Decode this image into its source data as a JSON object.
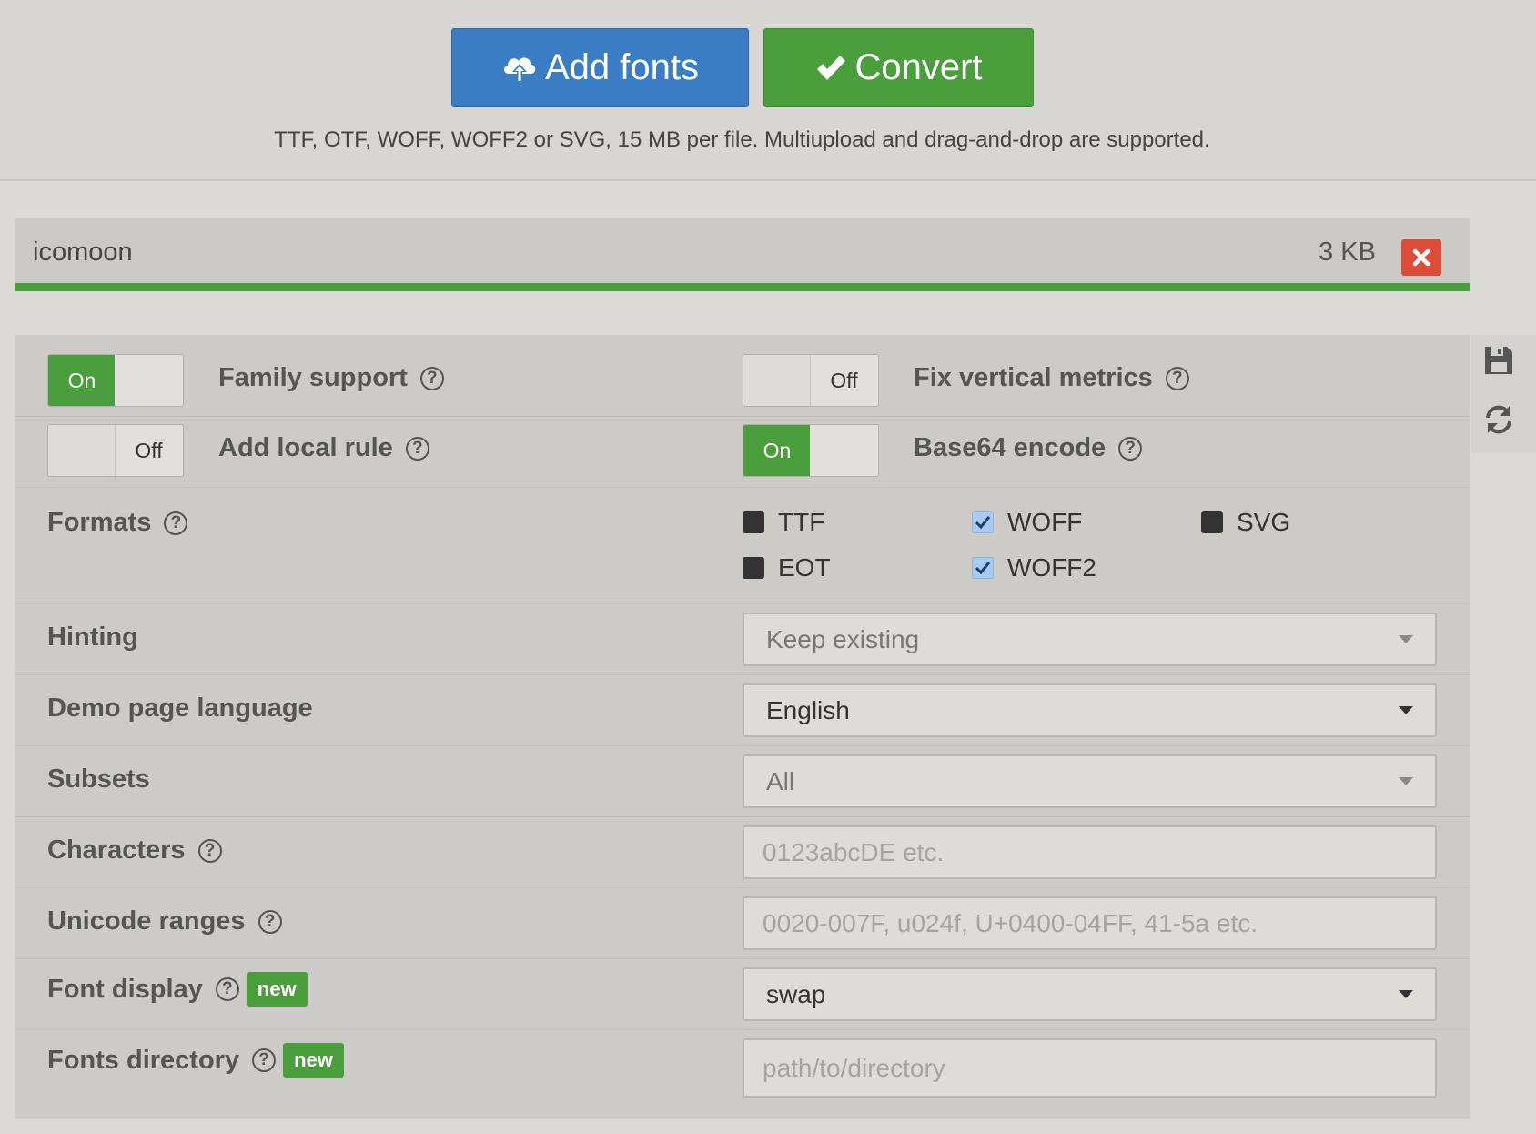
{
  "upload": {
    "add_fonts_label": "Add fonts",
    "convert_label": "Convert",
    "hint": "TTF, OTF, WOFF, WOFF2 or SVG, 15 MB per file. Multiupload and drag-and-drop are supported."
  },
  "file": {
    "name": "icomoon",
    "size": "3 KB",
    "progress": 1.0
  },
  "options": {
    "family_support": {
      "label": "Family support",
      "state": "On"
    },
    "fix_vertical_metrics": {
      "label": "Fix vertical metrics",
      "state": "Off"
    },
    "add_local_rule": {
      "label": "Add local rule",
      "state": "Off"
    },
    "base64_encode": {
      "label": "Base64 encode",
      "state": "On"
    },
    "formats": {
      "label": "Formats",
      "items": [
        {
          "label": "TTF",
          "checked": false
        },
        {
          "label": "WOFF",
          "checked": true
        },
        {
          "label": "SVG",
          "checked": false
        },
        {
          "label": "EOT",
          "checked": false
        },
        {
          "label": "WOFF2",
          "checked": true
        }
      ]
    },
    "hinting": {
      "label": "Hinting",
      "value": "Keep existing"
    },
    "demo_language": {
      "label": "Demo page language",
      "value": "English"
    },
    "subsets": {
      "label": "Subsets",
      "value": "All"
    },
    "characters": {
      "label": "Characters",
      "placeholder": "0123abcDE etc."
    },
    "unicode_ranges": {
      "label": "Unicode ranges",
      "placeholder": "0020-007F, u024f, U+0400-04FF, 41-5a etc."
    },
    "font_display": {
      "label": "Font display",
      "badge": "new",
      "value": "swap"
    },
    "fonts_directory": {
      "label": "Fonts directory",
      "badge": "new",
      "placeholder": "path/to/directory"
    }
  },
  "help_glyph": "?",
  "colors": {
    "primary": "#3a7dc4",
    "success": "#4a9e3c",
    "danger": "#dd4b39",
    "checkbox_checked": "#aacbee"
  }
}
